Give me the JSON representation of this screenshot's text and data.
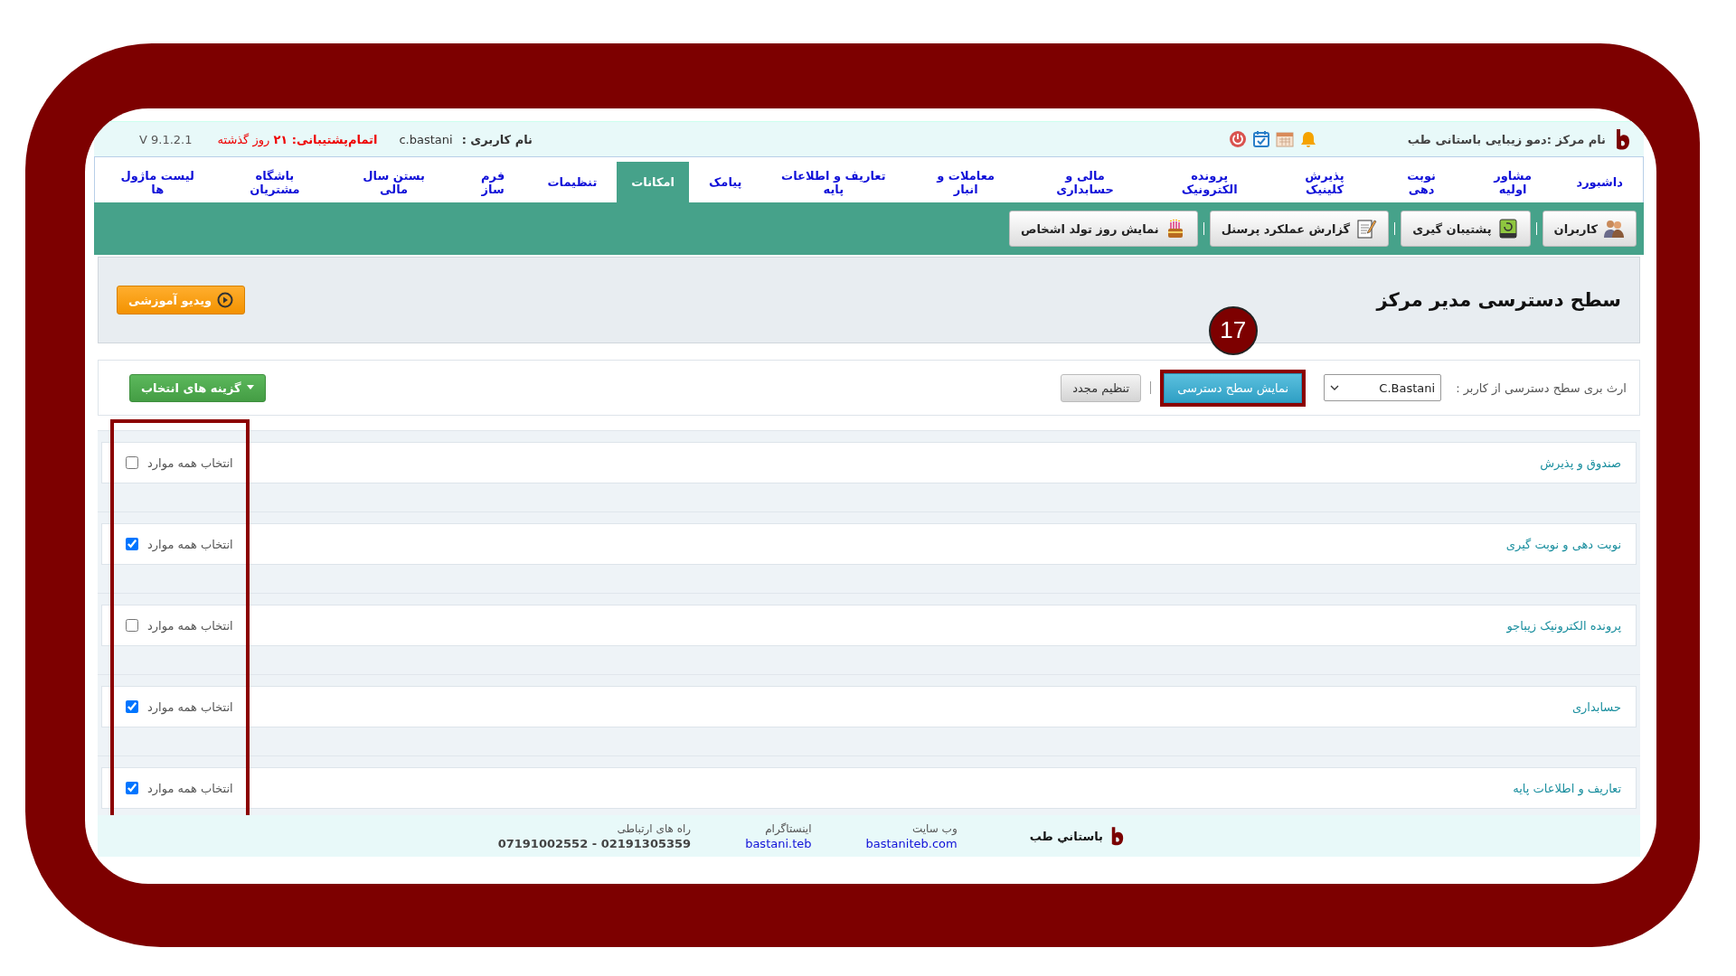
{
  "header": {
    "center_name": "نام مرکز :دمو زیبایی باستانی طب",
    "username_label": "نام کاربری :",
    "username": "c.bastani",
    "support": "**اتمام‌پشتیبانی: ۲۱** روز گذشته",
    "version": "V 9.1.2.1"
  },
  "nav": [
    {
      "label": "داشبورد",
      "selected": false
    },
    {
      "label": "مشاور اولیه",
      "selected": false
    },
    {
      "label": "نوبت دهی",
      "selected": false
    },
    {
      "label": "پذیرش کلینیک",
      "selected": false
    },
    {
      "label": "پرونده الکترونیک",
      "selected": false
    },
    {
      "label": "مالی و حسابداری",
      "selected": false
    },
    {
      "label": "معاملات و انبار",
      "selected": false
    },
    {
      "label": "تعاریف و اطلاعات پایه",
      "selected": false
    },
    {
      "label": "پیامک",
      "selected": false
    },
    {
      "label": "امکانات",
      "selected": true
    },
    {
      "label": "تنظیمات",
      "selected": false
    },
    {
      "label": "فرم ساز",
      "selected": false
    },
    {
      "label": "بستن سال مالی",
      "selected": false
    },
    {
      "label": "باشگاه مشتریان",
      "selected": false
    },
    {
      "label": "لیست ماژول ها",
      "selected": false
    }
  ],
  "toolbar": [
    {
      "label": "کاربران",
      "kind": "users"
    },
    {
      "label": "پشتیبان گیری",
      "kind": "backup"
    },
    {
      "label": "گزارش عملکرد پرسنل",
      "kind": "report"
    },
    {
      "label": "نمایش روز تولد اشخاص",
      "kind": "birthday"
    }
  ],
  "page_title": "سطح دسترسی مدیر مرکز",
  "video_button": "ویدیو آموزشی",
  "filter": {
    "label": "ارث بری سطح دسترسی از کاربر :",
    "user": "C.Bastani",
    "show_button": "نمایش سطح دسترسی",
    "reset_button": "تنظیم مجدد",
    "options_button": "گزینه های انتخاب"
  },
  "annotation": {
    "number": "17"
  },
  "sections": [
    {
      "title": "صندوق و پذیرش",
      "select_all": "انتخاب همه موارد",
      "checked": false
    },
    {
      "title": "نوبت دهی و نوبت گیری",
      "select_all": "انتخاب همه موارد",
      "checked": true
    },
    {
      "title": "پرونده الکترونیک زیباجو",
      "select_all": "انتخاب همه موارد",
      "checked": false
    },
    {
      "title": "حسابداری",
      "select_all": "انتخاب همه موارد",
      "checked": true
    },
    {
      "title": "تعاریف و اطلاعات پایه",
      "select_all": "انتخاب همه موارد",
      "checked": true
    }
  ],
  "footer": {
    "brand": "باستاني طب",
    "links": [
      {
        "label": "وب سایت",
        "value": "bastaniteb.com",
        "kind": "link"
      },
      {
        "label": "اینستاگرام",
        "value": "bastani.teb",
        "kind": "link"
      },
      {
        "label": "راه های ارتباطی",
        "value": "07191002552 - 02191305359",
        "kind": "phone"
      }
    ]
  }
}
